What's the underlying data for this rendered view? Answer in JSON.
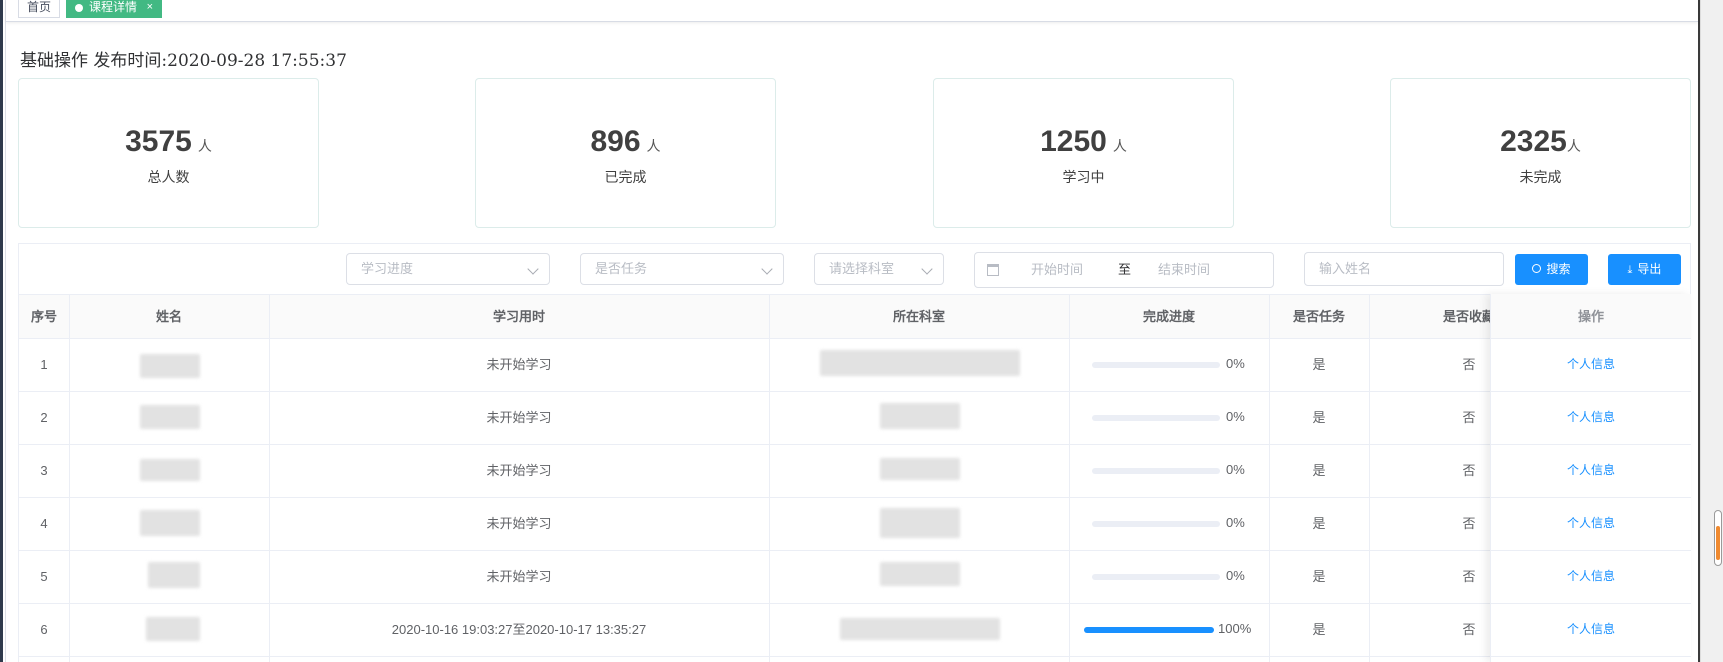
{
  "tabs": [
    {
      "label": "首页"
    },
    {
      "label": "课程详情",
      "close": "×"
    }
  ],
  "page_title": "基础操作 发布时间:2020-09-28 17:55:37",
  "stats": [
    {
      "value": "3575",
      "unit": "人",
      "label": "总人数"
    },
    {
      "value": "896",
      "unit": "人",
      "label": "已完成"
    },
    {
      "value": "1250",
      "unit": "人",
      "label": "学习中"
    },
    {
      "value": "2325",
      "unit": "人",
      "label": "未完成"
    }
  ],
  "filters": {
    "progress_placeholder": "学习进度",
    "task_placeholder": "是否任务",
    "dept_placeholder": "请选择科室",
    "start_placeholder": "开始时间",
    "range_sep": "至",
    "end_placeholder": "结束时间",
    "name_placeholder": "输入姓名",
    "search_label": "搜索",
    "export_label": "导出"
  },
  "table": {
    "columns": [
      "序号",
      "姓名",
      "学习用时",
      "所在科室",
      "完成进度",
      "是否任务",
      "是否收藏",
      "操作"
    ],
    "rows": [
      {
        "index": "1",
        "time": "未开始学习",
        "progress": 0,
        "progress_text": "0%",
        "task": "是",
        "fav": "否",
        "op": "个人信息"
      },
      {
        "index": "2",
        "time": "未开始学习",
        "progress": 0,
        "progress_text": "0%",
        "task": "是",
        "fav": "否",
        "op": "个人信息"
      },
      {
        "index": "3",
        "time": "未开始学习",
        "progress": 0,
        "progress_text": "0%",
        "task": "是",
        "fav": "否",
        "op": "个人信息"
      },
      {
        "index": "4",
        "time": "未开始学习",
        "progress": 0,
        "progress_text": "0%",
        "task": "是",
        "fav": "否",
        "op": "个人信息"
      },
      {
        "index": "5",
        "time": "未开始学习",
        "progress": 0,
        "progress_text": "0%",
        "task": "是",
        "fav": "否",
        "op": "个人信息"
      },
      {
        "index": "6",
        "time": "2020-10-16 19:03:27至2020-10-17 13:35:27",
        "progress": 100,
        "progress_text": "100%",
        "task": "是",
        "fav": "否",
        "op": "个人信息"
      }
    ]
  },
  "colors": {
    "accent": "#1890ff",
    "tab_active": "#42b983",
    "link": "#1890ff"
  }
}
